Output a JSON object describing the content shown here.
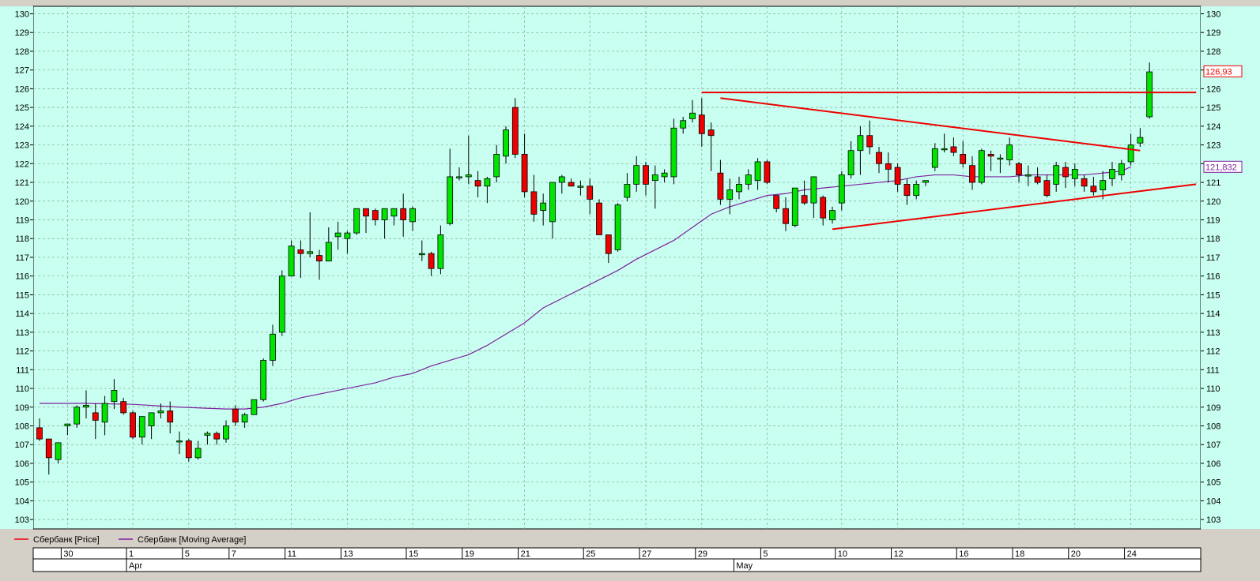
{
  "chart_data": {
    "type": "candlestick",
    "y_ticks": [
      103,
      104,
      105,
      106,
      107,
      108,
      109,
      110,
      111,
      112,
      113,
      114,
      115,
      116,
      117,
      118,
      119,
      120,
      121,
      122,
      123,
      124,
      125,
      126,
      127,
      128,
      129,
      130
    ],
    "x_tick_labels": [
      "30",
      "1",
      "5",
      "7",
      "11",
      "13",
      "15",
      "19",
      "21",
      "25",
      "27",
      "29",
      "5",
      "10",
      "12",
      "16",
      "18",
      "20",
      "24"
    ],
    "month_labels": [
      "Apr",
      "May"
    ],
    "price_label": "126,93",
    "ma_label": "121,832",
    "legend": [
      "Сбербанк [Price]",
      "Сбербанк [Moving Average]"
    ],
    "candles": [
      [
        107.9,
        108.4,
        107.2,
        107.3
      ],
      [
        107.3,
        107.3,
        105.4,
        106.3
      ],
      [
        106.2,
        107.1,
        106.0,
        107.1
      ],
      [
        108.0,
        108.1,
        107.5,
        108.1
      ],
      [
        108.1,
        109.1,
        107.9,
        109.0
      ],
      [
        109.0,
        109.9,
        108.4,
        109.1
      ],
      [
        108.7,
        109.2,
        107.3,
        108.3
      ],
      [
        108.2,
        109.6,
        107.5,
        109.2
      ],
      [
        109.3,
        110.5,
        108.9,
        109.9
      ],
      [
        109.3,
        109.5,
        108.6,
        108.7
      ],
      [
        108.7,
        108.8,
        107.3,
        107.4
      ],
      [
        107.4,
        108.5,
        107.0,
        108.5
      ],
      [
        108.0,
        108.7,
        107.3,
        108.7
      ],
      [
        108.7,
        109.2,
        108.4,
        108.8
      ],
      [
        108.8,
        109.3,
        107.6,
        108.2
      ],
      [
        107.2,
        107.7,
        106.5,
        107.2
      ],
      [
        107.2,
        107.3,
        106.1,
        106.3
      ],
      [
        106.3,
        107.2,
        106.2,
        106.8
      ],
      [
        107.5,
        107.7,
        107.0,
        107.6
      ],
      [
        107.6,
        107.7,
        107.0,
        107.3
      ],
      [
        107.3,
        108.3,
        107.1,
        108.0
      ],
      [
        108.9,
        109.1,
        108.0,
        108.2
      ],
      [
        108.2,
        108.7,
        107.9,
        108.6
      ],
      [
        108.6,
        109.4,
        108.6,
        109.4
      ],
      [
        109.4,
        111.6,
        109.3,
        111.5
      ],
      [
        111.5,
        113.4,
        111.2,
        112.9
      ],
      [
        113.0,
        116.3,
        112.8,
        116.0
      ],
      [
        116.0,
        117.9,
        116.0,
        117.6
      ],
      [
        117.4,
        117.9,
        115.9,
        117.2
      ],
      [
        117.2,
        119.4,
        117.0,
        117.3
      ],
      [
        117.1,
        117.4,
        115.8,
        116.8
      ],
      [
        116.8,
        118.6,
        116.8,
        117.8
      ],
      [
        118.1,
        118.9,
        117.4,
        118.3
      ],
      [
        118.0,
        118.4,
        117.2,
        118.3
      ],
      [
        118.3,
        119.6,
        118.2,
        119.6
      ],
      [
        119.6,
        119.6,
        118.3,
        119.2
      ],
      [
        119.5,
        119.6,
        118.7,
        119.0
      ],
      [
        119.0,
        119.5,
        118.0,
        119.6
      ],
      [
        119.2,
        119.6,
        118.7,
        119.6
      ],
      [
        119.6,
        120.4,
        118.1,
        119.0
      ],
      [
        118.9,
        119.7,
        118.4,
        119.6
      ],
      [
        117.2,
        117.9,
        116.8,
        117.2
      ],
      [
        117.2,
        117.3,
        116.0,
        116.4
      ],
      [
        116.4,
        118.7,
        116.1,
        118.2
      ],
      [
        118.8,
        122.8,
        118.7,
        121.3
      ],
      [
        121.3,
        121.8,
        121.1,
        121.3
      ],
      [
        121.3,
        123.5,
        120.9,
        121.4
      ],
      [
        121.1,
        121.6,
        120.2,
        120.8
      ],
      [
        120.8,
        121.3,
        119.9,
        121.2
      ],
      [
        121.3,
        123.0,
        121.0,
        122.5
      ],
      [
        122.4,
        124.0,
        122.0,
        123.8
      ],
      [
        125.0,
        125.5,
        122.3,
        122.5
      ],
      [
        122.5,
        123.6,
        120.2,
        120.5
      ],
      [
        120.5,
        121.4,
        118.9,
        119.3
      ],
      [
        119.5,
        120.4,
        118.7,
        119.9
      ],
      [
        118.9,
        120.8,
        118.0,
        121.0
      ],
      [
        121.0,
        121.4,
        120.4,
        121.3
      ],
      [
        121.0,
        121.2,
        120.8,
        120.8
      ],
      [
        120.8,
        121.1,
        120.3,
        120.8
      ],
      [
        120.8,
        121.2,
        119.3,
        120.1
      ],
      [
        119.9,
        120.1,
        118.4,
        118.2
      ],
      [
        118.2,
        117.8,
        116.7,
        117.2
      ],
      [
        117.4,
        119.9,
        117.3,
        119.8
      ],
      [
        120.2,
        121.5,
        120.0,
        120.9
      ],
      [
        120.9,
        122.4,
        120.5,
        121.9
      ],
      [
        121.9,
        122.1,
        120.3,
        120.9
      ],
      [
        121.1,
        121.9,
        119.6,
        121.4
      ],
      [
        121.3,
        121.7,
        121.0,
        121.5
      ],
      [
        121.3,
        124.4,
        120.9,
        123.9
      ],
      [
        123.9,
        124.5,
        123.6,
        124.3
      ],
      [
        124.4,
        125.4,
        124.2,
        124.7
      ],
      [
        124.6,
        125.5,
        122.9,
        123.6
      ],
      [
        123.8,
        124.2,
        121.6,
        123.5
      ],
      [
        121.5,
        122.2,
        119.8,
        120.1
      ],
      [
        120.1,
        121.2,
        119.3,
        120.6
      ],
      [
        120.5,
        121.3,
        120.1,
        120.9
      ],
      [
        120.9,
        121.7,
        120.6,
        121.4
      ],
      [
        121.1,
        122.3,
        120.6,
        122.1
      ],
      [
        122.1,
        122.2,
        120.9,
        121.0
      ],
      [
        120.3,
        120.3,
        119.4,
        119.6
      ],
      [
        119.6,
        120.2,
        118.4,
        118.8
      ],
      [
        118.7,
        120.6,
        118.6,
        120.7
      ],
      [
        120.3,
        121.1,
        119.8,
        119.9
      ],
      [
        119.9,
        121.3,
        119.1,
        121.3
      ],
      [
        120.2,
        120.3,
        118.7,
        119.1
      ],
      [
        119.0,
        119.7,
        118.8,
        119.5
      ],
      [
        119.9,
        121.6,
        119.5,
        121.4
      ],
      [
        121.4,
        123.2,
        121.2,
        122.7
      ],
      [
        122.7,
        124.0,
        121.4,
        123.5
      ],
      [
        123.5,
        124.3,
        122.5,
        122.9
      ],
      [
        122.6,
        122.9,
        121.5,
        122.0
      ],
      [
        122.0,
        122.6,
        121.0,
        121.7
      ],
      [
        121.8,
        122.0,
        120.5,
        120.9
      ],
      [
        120.9,
        121.2,
        119.8,
        120.3
      ],
      [
        120.3,
        121.1,
        120.1,
        120.9
      ],
      [
        121.0,
        121.1,
        120.8,
        121.1
      ],
      [
        121.8,
        123.1,
        121.6,
        122.8
      ],
      [
        122.8,
        123.6,
        122.6,
        122.8
      ],
      [
        122.9,
        123.4,
        122.4,
        122.6
      ],
      [
        122.5,
        123.2,
        121.8,
        122.0
      ],
      [
        121.9,
        122.4,
        120.6,
        121.0
      ],
      [
        121.0,
        122.8,
        120.9,
        122.7
      ],
      [
        122.5,
        122.7,
        121.6,
        122.4
      ],
      [
        122.3,
        122.5,
        121.5,
        122.3
      ],
      [
        122.2,
        123.4,
        121.9,
        123.0
      ],
      [
        122.0,
        122.1,
        121.0,
        121.4
      ],
      [
        121.4,
        121.9,
        120.8,
        121.4
      ],
      [
        121.3,
        121.8,
        120.9,
        121.0
      ],
      [
        121.1,
        121.4,
        120.2,
        120.3
      ],
      [
        120.9,
        122.1,
        120.5,
        121.9
      ],
      [
        121.8,
        122.1,
        120.7,
        121.3
      ],
      [
        121.2,
        122.0,
        120.8,
        121.7
      ],
      [
        121.2,
        121.4,
        120.5,
        120.8
      ],
      [
        120.8,
        121.3,
        120.3,
        120.5
      ],
      [
        120.6,
        121.6,
        120.1,
        121.1
      ],
      [
        121.2,
        122.1,
        120.8,
        121.7
      ],
      [
        121.4,
        122.2,
        121.1,
        122.0
      ],
      [
        122.1,
        123.6,
        121.9,
        123.0
      ],
      [
        123.1,
        123.9,
        122.9,
        123.4
      ],
      [
        124.5,
        127.4,
        124.4,
        126.9
      ]
    ],
    "ma": [
      [
        0,
        109.2
      ],
      [
        5,
        109.2
      ],
      [
        10,
        109.15
      ],
      [
        15,
        109.0
      ],
      [
        20,
        108.9
      ],
      [
        22,
        108.9
      ],
      [
        24,
        109.0
      ],
      [
        26,
        109.2
      ],
      [
        28,
        109.5
      ],
      [
        30,
        109.7
      ],
      [
        32,
        109.9
      ],
      [
        34,
        110.1
      ],
      [
        36,
        110.3
      ],
      [
        38,
        110.6
      ],
      [
        40,
        110.8
      ],
      [
        42,
        111.2
      ],
      [
        44,
        111.5
      ],
      [
        46,
        111.8
      ],
      [
        48,
        112.3
      ],
      [
        50,
        112.9
      ],
      [
        52,
        113.5
      ],
      [
        54,
        114.3
      ],
      [
        56,
        114.8
      ],
      [
        58,
        115.3
      ],
      [
        60,
        115.8
      ],
      [
        62,
        116.3
      ],
      [
        64,
        116.9
      ],
      [
        66,
        117.4
      ],
      [
        68,
        117.9
      ],
      [
        70,
        118.6
      ],
      [
        72,
        119.3
      ],
      [
        74,
        119.7
      ],
      [
        76,
        120.0
      ],
      [
        78,
        120.3
      ],
      [
        80,
        120.4
      ],
      [
        82,
        120.6
      ],
      [
        84,
        120.7
      ],
      [
        86,
        120.8
      ],
      [
        88,
        120.9
      ],
      [
        90,
        121.0
      ],
      [
        92,
        121.1
      ],
      [
        94,
        121.3
      ],
      [
        96,
        121.4
      ],
      [
        98,
        121.4
      ],
      [
        100,
        121.3
      ],
      [
        102,
        121.3
      ],
      [
        104,
        121.3
      ],
      [
        106,
        121.4
      ],
      [
        108,
        121.4
      ],
      [
        110,
        121.4
      ],
      [
        112,
        121.4
      ],
      [
        114,
        121.5
      ],
      [
        116,
        121.6
      ],
      [
        117,
        121.832
      ]
    ],
    "lines": [
      {
        "from": [
          71,
          125.8
        ],
        "to": [
          124,
          125.8
        ]
      },
      {
        "from": [
          73,
          125.5
        ],
        "to": [
          118,
          122.7
        ]
      },
      {
        "from": [
          85,
          118.5
        ],
        "to": [
          124,
          120.9
        ]
      }
    ]
  },
  "colors": {
    "background": "#c8fff0",
    "up": "#00e400",
    "down": "#ee0000",
    "ma": "#8020a0",
    "trend": "#ee0000",
    "price_tag": "#ee0000",
    "ma_tag": "#8020a0",
    "grid": "#88aa99"
  }
}
